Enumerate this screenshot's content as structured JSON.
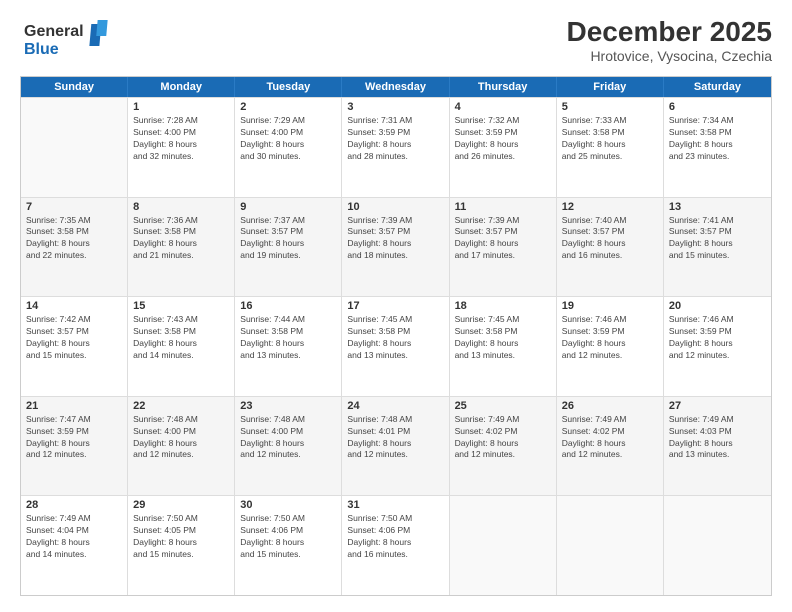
{
  "logo": {
    "line1": "General",
    "line2": "Blue"
  },
  "title": "December 2025",
  "subtitle": "Hrotovice, Vysocina, Czechia",
  "days": [
    "Sunday",
    "Monday",
    "Tuesday",
    "Wednesday",
    "Thursday",
    "Friday",
    "Saturday"
  ],
  "weeks": [
    [
      {
        "day": "",
        "info": ""
      },
      {
        "day": "1",
        "info": "Sunrise: 7:28 AM\nSunset: 4:00 PM\nDaylight: 8 hours\nand 32 minutes."
      },
      {
        "day": "2",
        "info": "Sunrise: 7:29 AM\nSunset: 4:00 PM\nDaylight: 8 hours\nand 30 minutes."
      },
      {
        "day": "3",
        "info": "Sunrise: 7:31 AM\nSunset: 3:59 PM\nDaylight: 8 hours\nand 28 minutes."
      },
      {
        "day": "4",
        "info": "Sunrise: 7:32 AM\nSunset: 3:59 PM\nDaylight: 8 hours\nand 26 minutes."
      },
      {
        "day": "5",
        "info": "Sunrise: 7:33 AM\nSunset: 3:58 PM\nDaylight: 8 hours\nand 25 minutes."
      },
      {
        "day": "6",
        "info": "Sunrise: 7:34 AM\nSunset: 3:58 PM\nDaylight: 8 hours\nand 23 minutes."
      }
    ],
    [
      {
        "day": "7",
        "info": "Sunrise: 7:35 AM\nSunset: 3:58 PM\nDaylight: 8 hours\nand 22 minutes."
      },
      {
        "day": "8",
        "info": "Sunrise: 7:36 AM\nSunset: 3:58 PM\nDaylight: 8 hours\nand 21 minutes."
      },
      {
        "day": "9",
        "info": "Sunrise: 7:37 AM\nSunset: 3:57 PM\nDaylight: 8 hours\nand 19 minutes."
      },
      {
        "day": "10",
        "info": "Sunrise: 7:39 AM\nSunset: 3:57 PM\nDaylight: 8 hours\nand 18 minutes."
      },
      {
        "day": "11",
        "info": "Sunrise: 7:39 AM\nSunset: 3:57 PM\nDaylight: 8 hours\nand 17 minutes."
      },
      {
        "day": "12",
        "info": "Sunrise: 7:40 AM\nSunset: 3:57 PM\nDaylight: 8 hours\nand 16 minutes."
      },
      {
        "day": "13",
        "info": "Sunrise: 7:41 AM\nSunset: 3:57 PM\nDaylight: 8 hours\nand 15 minutes."
      }
    ],
    [
      {
        "day": "14",
        "info": "Sunrise: 7:42 AM\nSunset: 3:57 PM\nDaylight: 8 hours\nand 15 minutes."
      },
      {
        "day": "15",
        "info": "Sunrise: 7:43 AM\nSunset: 3:58 PM\nDaylight: 8 hours\nand 14 minutes."
      },
      {
        "day": "16",
        "info": "Sunrise: 7:44 AM\nSunset: 3:58 PM\nDaylight: 8 hours\nand 13 minutes."
      },
      {
        "day": "17",
        "info": "Sunrise: 7:45 AM\nSunset: 3:58 PM\nDaylight: 8 hours\nand 13 minutes."
      },
      {
        "day": "18",
        "info": "Sunrise: 7:45 AM\nSunset: 3:58 PM\nDaylight: 8 hours\nand 13 minutes."
      },
      {
        "day": "19",
        "info": "Sunrise: 7:46 AM\nSunset: 3:59 PM\nDaylight: 8 hours\nand 12 minutes."
      },
      {
        "day": "20",
        "info": "Sunrise: 7:46 AM\nSunset: 3:59 PM\nDaylight: 8 hours\nand 12 minutes."
      }
    ],
    [
      {
        "day": "21",
        "info": "Sunrise: 7:47 AM\nSunset: 3:59 PM\nDaylight: 8 hours\nand 12 minutes."
      },
      {
        "day": "22",
        "info": "Sunrise: 7:48 AM\nSunset: 4:00 PM\nDaylight: 8 hours\nand 12 minutes."
      },
      {
        "day": "23",
        "info": "Sunrise: 7:48 AM\nSunset: 4:00 PM\nDaylight: 8 hours\nand 12 minutes."
      },
      {
        "day": "24",
        "info": "Sunrise: 7:48 AM\nSunset: 4:01 PM\nDaylight: 8 hours\nand 12 minutes."
      },
      {
        "day": "25",
        "info": "Sunrise: 7:49 AM\nSunset: 4:02 PM\nDaylight: 8 hours\nand 12 minutes."
      },
      {
        "day": "26",
        "info": "Sunrise: 7:49 AM\nSunset: 4:02 PM\nDaylight: 8 hours\nand 12 minutes."
      },
      {
        "day": "27",
        "info": "Sunrise: 7:49 AM\nSunset: 4:03 PM\nDaylight: 8 hours\nand 13 minutes."
      }
    ],
    [
      {
        "day": "28",
        "info": "Sunrise: 7:49 AM\nSunset: 4:04 PM\nDaylight: 8 hours\nand 14 minutes."
      },
      {
        "day": "29",
        "info": "Sunrise: 7:50 AM\nSunset: 4:05 PM\nDaylight: 8 hours\nand 15 minutes."
      },
      {
        "day": "30",
        "info": "Sunrise: 7:50 AM\nSunset: 4:06 PM\nDaylight: 8 hours\nand 15 minutes."
      },
      {
        "day": "31",
        "info": "Sunrise: 7:50 AM\nSunset: 4:06 PM\nDaylight: 8 hours\nand 16 minutes."
      },
      {
        "day": "",
        "info": ""
      },
      {
        "day": "",
        "info": ""
      },
      {
        "day": "",
        "info": ""
      }
    ]
  ]
}
